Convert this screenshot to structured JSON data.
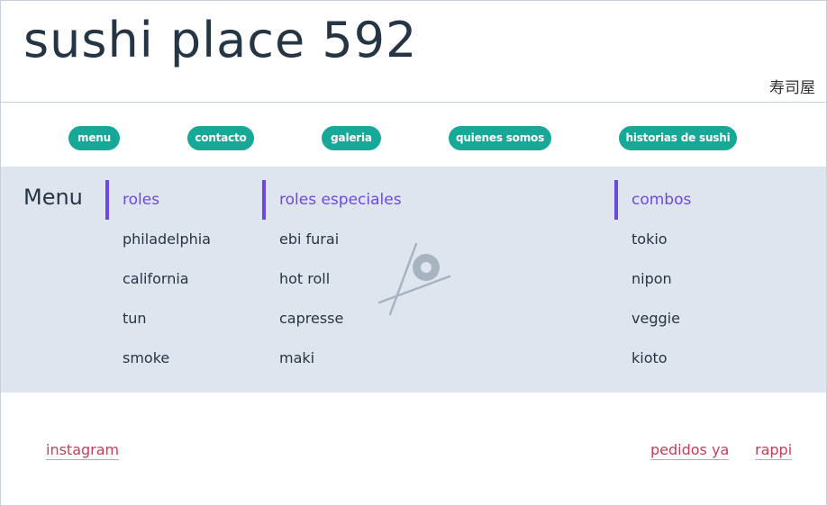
{
  "header": {
    "title": "sushi place 592",
    "kanji": "寿司屋"
  },
  "nav": [
    {
      "label": "menu"
    },
    {
      "label": "contacto"
    },
    {
      "label": "galeria"
    },
    {
      "label": "quienes somos"
    },
    {
      "label": "historias de sushi"
    }
  ],
  "menu": {
    "heading": "Menu",
    "columns": [
      {
        "title": "roles",
        "items": [
          "philadelphia",
          "california",
          "tun",
          "smoke"
        ]
      },
      {
        "title": "roles especiales",
        "items": [
          "ebi furai",
          "hot roll",
          "capresse",
          "maki"
        ]
      },
      {
        "title": "combos",
        "items": [
          "tokio",
          "nipon",
          "veggie",
          "kioto"
        ]
      }
    ]
  },
  "footer": {
    "instagram": "instagram",
    "pedidos": "pedidos ya",
    "rappi": "rappi"
  },
  "colors": {
    "accent_green": "#17a898",
    "accent_purple": "#6a4ae0",
    "link_red": "#c53e57",
    "band_bg": "#dfe5ee"
  },
  "icons": {
    "logo": "sushi-chopsticks-icon"
  }
}
